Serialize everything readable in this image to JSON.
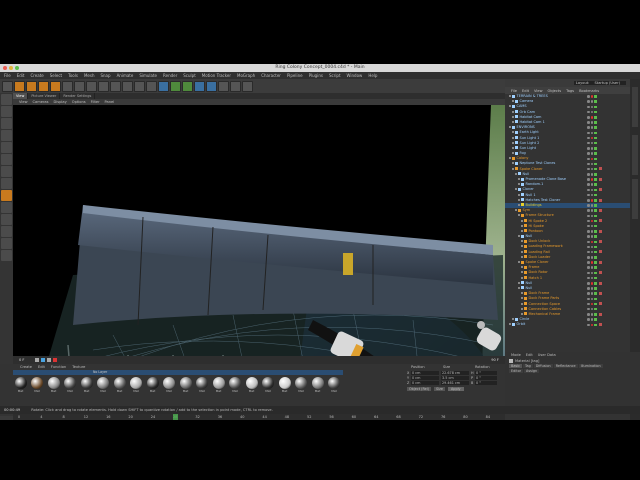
{
  "window": {
    "title": "Ring Colony Concept_0004.c4d * - Main"
  },
  "menubar": {
    "items": [
      "File",
      "Edit",
      "Create",
      "Select",
      "Tools",
      "Mesh",
      "Snap",
      "Animate",
      "Simulate",
      "Render",
      "Sculpt",
      "Motion Tracker",
      "MoGraph",
      "Character",
      "Pipeline",
      "Plugins",
      "Script",
      "Window",
      "Help"
    ]
  },
  "viewport": {
    "tabs": [
      "View",
      "Picture Viewer",
      "Render Settings"
    ],
    "menu": [
      "View",
      "Cameras",
      "Display",
      "Options",
      "Filter",
      "Panel"
    ]
  },
  "object_manager": {
    "tabs": [
      "File",
      "Edit",
      "View",
      "Objects",
      "Tags",
      "Bookmarks"
    ],
    "layout_label": "Layout:",
    "layout_value": "Startup (User)",
    "rows": [
      {
        "label": "TERRAIN & TREES",
        "color": "#9fd0ff"
      },
      {
        "label": "Camera",
        "color": "#9fd0ff"
      },
      {
        "label": "CAMS",
        "color": "#9fd0ff"
      },
      {
        "label": "Orb Cam",
        "color": "#9fd0ff"
      },
      {
        "label": "Habitat Cam",
        "color": "#9fd0ff"
      },
      {
        "label": "Habitat Cam 1",
        "color": "#9fd0ff"
      },
      {
        "label": "ENVIRONS",
        "color": "#9fd0ff"
      },
      {
        "label": "Earth Light",
        "color": "#9fd0ff"
      },
      {
        "label": "Sun Light 1",
        "color": "#9fd0ff"
      },
      {
        "label": "Sun Light 2",
        "color": "#9fd0ff"
      },
      {
        "label": "Sun Light",
        "color": "#9fd0ff"
      },
      {
        "label": "Fog",
        "color": "#9fd0ff"
      },
      {
        "label": "Colony",
        "color": "#e89a2a"
      },
      {
        "label": "Neptune Test Clones",
        "color": "#9fd0ff"
      },
      {
        "label": "Spoke Cloner",
        "color": "#e89a2a"
      },
      {
        "label": "Null",
        "color": "#9fd0ff"
      },
      {
        "label": "Promenade Clone Base",
        "color": "#9fd0ff"
      },
      {
        "label": "Random.1",
        "color": "#9fd0ff"
      },
      {
        "label": "Cloner",
        "color": "#9fd0ff"
      },
      {
        "label": "Null 1",
        "color": "#9fd0ff"
      },
      {
        "label": "Hatches Test Cloner",
        "color": "#9fd0ff"
      },
      {
        "label": "Buildings",
        "color": "#e8d02a"
      },
      {
        "label": "Sym",
        "color": "#e89a2a"
      },
      {
        "label": "Frame Structure",
        "color": "#e89a2a"
      },
      {
        "label": "Hi Spoke 2",
        "color": "#e89a2a"
      },
      {
        "label": "Hi Spoke",
        "color": "#e89a2a"
      },
      {
        "label": "Pontoon",
        "color": "#e89a2a"
      },
      {
        "label": "Null",
        "color": "#9fd0ff"
      },
      {
        "label": "Dock Unlock",
        "color": "#e89a2a"
      },
      {
        "label": "Loading Framework",
        "color": "#e89a2a"
      },
      {
        "label": "Loading Rail",
        "color": "#e89a2a"
      },
      {
        "label": "Dock Loader",
        "color": "#e89a2a"
      },
      {
        "label": "Spoke Cloner",
        "color": "#e89a2a"
      },
      {
        "label": "Frame",
        "color": "#e89a2a"
      },
      {
        "label": "Dock Rotor",
        "color": "#e89a2a"
      },
      {
        "label": "Hatch 1",
        "color": "#e89a2a"
      },
      {
        "label": "Null",
        "color": "#9fd0ff"
      },
      {
        "label": "Null",
        "color": "#9fd0ff"
      },
      {
        "label": "Dock Frame",
        "color": "#e89a2a"
      },
      {
        "label": "Dock Frame Parts",
        "color": "#e89a2a"
      },
      {
        "label": "Connection Space",
        "color": "#e89a2a"
      },
      {
        "label": "Connection Cables",
        "color": "#e89a2a"
      },
      {
        "label": "Mechanical Frame",
        "color": "#e89a2a"
      },
      {
        "label": "Circle",
        "color": "#9fd0ff"
      },
      {
        "label": "Orbit",
        "color": "#9fd0ff"
      }
    ]
  },
  "attributes": {
    "menu": [
      "Mode",
      "Edit",
      "User Data"
    ],
    "object_label": "Material [tag]",
    "tabs": [
      "Basic",
      "Tag",
      "Diffusion",
      "Reflectance",
      "Illumination"
    ],
    "subtabs": [
      "Editor",
      "Assign"
    ]
  },
  "timeline": {
    "ticks": [
      "0",
      "2",
      "4",
      "6",
      "8",
      "10",
      "12",
      "14",
      "16",
      "18",
      "20",
      "22",
      "24",
      "26",
      "28",
      "30",
      "32",
      "34",
      "36",
      "38",
      "40",
      "42",
      "44",
      "46",
      "48",
      "50",
      "52",
      "54",
      "56",
      "58",
      "60",
      "62",
      "64",
      "66",
      "68",
      "70",
      "72",
      "74",
      "76",
      "78",
      "80",
      "82",
      "84",
      "86"
    ],
    "current_frame": "0 F",
    "end_frame": "90 F"
  },
  "material_manager": {
    "menu": [
      "Create",
      "Edit",
      "Function",
      "Texture"
    ],
    "filter_label": "No Layer",
    "materials": [
      "Mat",
      "Mat",
      "Mat",
      "Mat",
      "Mat",
      "Mat",
      "Mat",
      "Mat",
      "Mat",
      "Mat",
      "Mat",
      "Mat",
      "Mat",
      "Mat",
      "Mat",
      "Mat",
      "Mat",
      "Mat",
      "Mat",
      "Mat"
    ]
  },
  "coordinates": {
    "headers": [
      "Position",
      "Size",
      "Rotation"
    ],
    "rows": [
      {
        "axis": "X",
        "pos": "0 cm",
        "size": "22.678 cm",
        "rot_label": "H",
        "rot": "0 °"
      },
      {
        "axis": "Y",
        "pos": "0 cm",
        "size": "3.5 cm",
        "rot_label": "P",
        "rot": "0 °"
      },
      {
        "axis": "Z",
        "pos": "0 cm",
        "size": "29.461 cm",
        "rot_label": "B",
        "rot": "0 °"
      }
    ],
    "mode_object": "Object (Rel)",
    "mode_size": "Size",
    "apply": "Apply"
  },
  "status": {
    "time": "00:00:49",
    "message": "Rotate: Click and drag to rotate elements. Hold down SHIFT to quantize rotation / add to the selection in point mode, CTRL to remove."
  },
  "colors": {
    "accent": "#c87a1e",
    "selection": "#3a6fa0"
  }
}
